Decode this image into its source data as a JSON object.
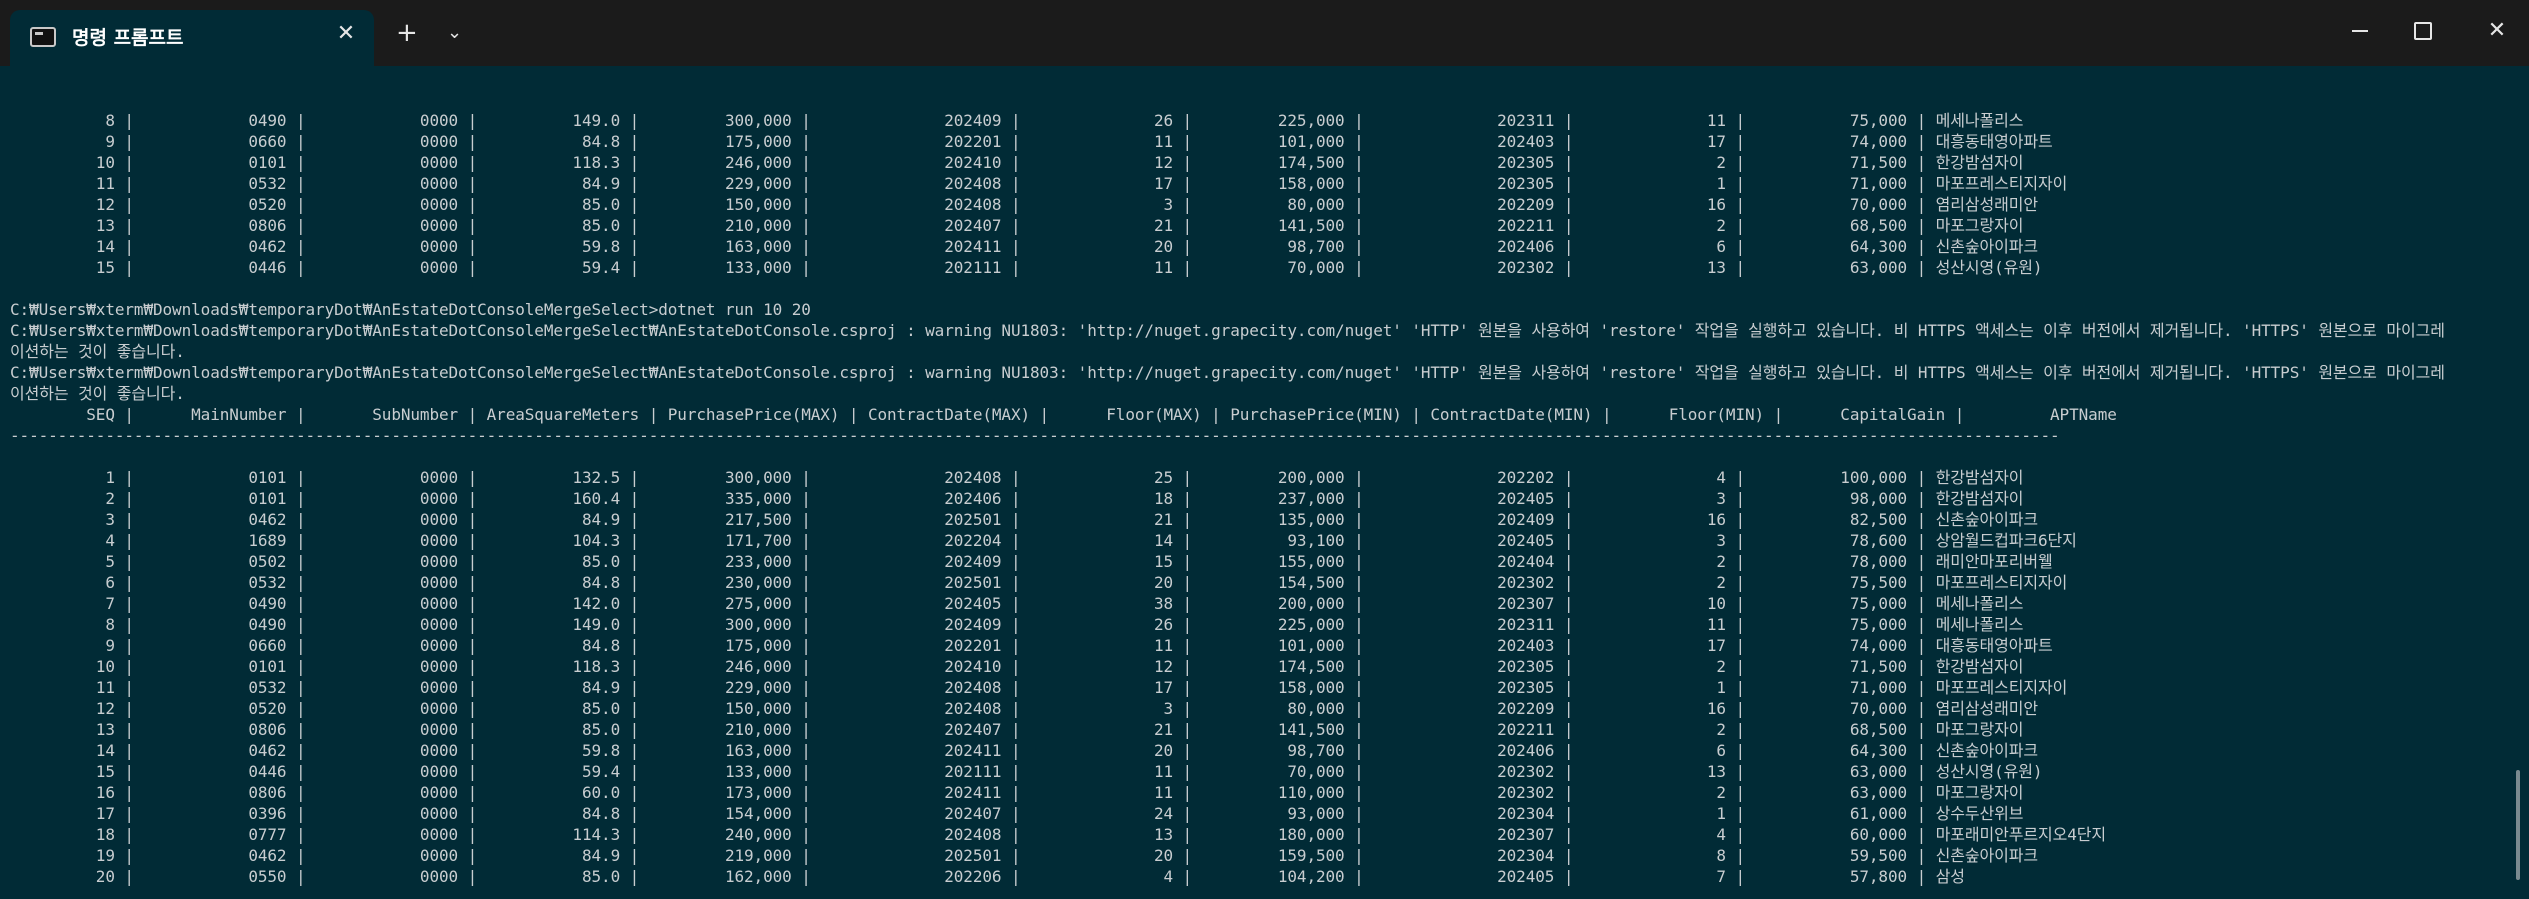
{
  "window": {
    "tab_title": "명령 프롬프트",
    "tab_icon": "terminal-icon",
    "close_tab_glyph": "✕",
    "new_tab_glyph": "+",
    "dropdown_glyph": "⌄",
    "close_window_glyph": "✕"
  },
  "terminal": {
    "lines": [
      "          8 |            0490 |            0000 |          149.0 |         300,000 |              202409 |              26 |         225,000 |              202311 |              11 |           75,000 | 메세나폴리스",
      "          9 |            0660 |            0000 |           84.8 |         175,000 |              202201 |              11 |         101,000 |              202403 |              17 |           74,000 | 대흥동태영아파트",
      "         10 |            0101 |            0000 |          118.3 |         246,000 |              202410 |              12 |         174,500 |              202305 |               2 |           71,500 | 한강밤섬자이",
      "         11 |            0532 |            0000 |           84.9 |         229,000 |              202408 |              17 |         158,000 |              202305 |               1 |           71,000 | 마포프레스티지자이",
      "         12 |            0520 |            0000 |           85.0 |         150,000 |              202408 |               3 |          80,000 |              202209 |              16 |           70,000 | 염리삼성래미안",
      "         13 |            0806 |            0000 |           85.0 |         210,000 |              202407 |              21 |         141,500 |              202211 |               2 |           68,500 | 마포그랑자이",
      "         14 |            0462 |            0000 |           59.8 |         163,000 |              202411 |              20 |          98,700 |              202406 |               6 |           64,300 | 신촌숲아이파크",
      "         15 |            0446 |            0000 |           59.4 |         133,000 |              202111 |              11 |          70,000 |              202302 |              13 |           63,000 | 성산시영(유원)",
      "",
      "C:₩Users₩xterm₩Downloads₩temporaryDot₩AnEstateDotConsoleMergeSelect>dotnet run 10 20",
      "C:₩Users₩xterm₩Downloads₩temporaryDot₩AnEstateDotConsoleMergeSelect₩AnEstateDotConsole.csproj : warning NU1803: 'http://nuget.grapecity.com/nuget' 'HTTP' 원본을 사용하여 'restore' 작업을 실행하고 있습니다. 비 HTTPS 액세스는 이후 버전에서 제거됩니다. 'HTTPS' 원본으로 마이그레",
      "이션하는 것이 좋습니다.",
      "C:₩Users₩xterm₩Downloads₩temporaryDot₩AnEstateDotConsoleMergeSelect₩AnEstateDotConsole.csproj : warning NU1803: 'http://nuget.grapecity.com/nuget' 'HTTP' 원본을 사용하여 'restore' 작업을 실행하고 있습니다. 비 HTTPS 액세스는 이후 버전에서 제거됩니다. 'HTTPS' 원본으로 마이그레",
      "이션하는 것이 좋습니다.",
      "        SEQ |      MainNumber |       SubNumber | AreaSquareMeters | PurchasePrice(MAX) | ContractDate(MAX) |      Floor(MAX) | PurchasePrice(MIN) | ContractDate(MIN) |      Floor(MIN) |      CapitalGain |         APTName",
      "-----------------------------------------------------------------------------------------------------------------------------------------------------------------------------------------------------------------------",
      "",
      "          1 |            0101 |            0000 |          132.5 |         300,000 |              202408 |              25 |         200,000 |              202202 |               4 |          100,000 | 한강밤섬자이",
      "          2 |            0101 |            0000 |          160.4 |         335,000 |              202406 |              18 |         237,000 |              202405 |               3 |           98,000 | 한강밤섬자이",
      "          3 |            0462 |            0000 |           84.9 |         217,500 |              202501 |              21 |         135,000 |              202409 |              16 |           82,500 | 신촌숲아이파크",
      "          4 |            1689 |            0000 |          104.3 |         171,700 |              202204 |              14 |          93,100 |              202405 |               3 |           78,600 | 상암월드컵파크6단지",
      "          5 |            0502 |            0000 |           85.0 |         233,000 |              202409 |              15 |         155,000 |              202404 |               2 |           78,000 | 래미안마포리버웰",
      "          6 |            0532 |            0000 |           84.8 |         230,000 |              202501 |              20 |         154,500 |              202302 |               2 |           75,500 | 마포프레스티지자이",
      "          7 |            0490 |            0000 |          142.0 |         275,000 |              202405 |              38 |         200,000 |              202307 |              10 |           75,000 | 메세나폴리스",
      "          8 |            0490 |            0000 |          149.0 |         300,000 |              202409 |              26 |         225,000 |              202311 |              11 |           75,000 | 메세나폴리스",
      "          9 |            0660 |            0000 |           84.8 |         175,000 |              202201 |              11 |         101,000 |              202403 |              17 |           74,000 | 대흥동태영아파트",
      "         10 |            0101 |            0000 |          118.3 |         246,000 |              202410 |              12 |         174,500 |              202305 |               2 |           71,500 | 한강밤섬자이",
      "         11 |            0532 |            0000 |           84.9 |         229,000 |              202408 |              17 |         158,000 |              202305 |               1 |           71,000 | 마포프레스티지자이",
      "         12 |            0520 |            0000 |           85.0 |         150,000 |              202408 |               3 |          80,000 |              202209 |              16 |           70,000 | 염리삼성래미안",
      "         13 |            0806 |            0000 |           85.0 |         210,000 |              202407 |              21 |         141,500 |              202211 |               2 |           68,500 | 마포그랑자이",
      "         14 |            0462 |            0000 |           59.8 |         163,000 |              202411 |              20 |          98,700 |              202406 |               6 |           64,300 | 신촌숲아이파크",
      "         15 |            0446 |            0000 |           59.4 |         133,000 |              202111 |              11 |          70,000 |              202302 |              13 |           63,000 | 성산시영(유원)",
      "         16 |            0806 |            0000 |           60.0 |         173,000 |              202411 |              11 |         110,000 |              202302 |               2 |           63,000 | 마포그랑자이",
      "         17 |            0396 |            0000 |           84.8 |         154,000 |              202407 |              24 |          93,000 |              202304 |               1 |           61,000 | 상수두산위브",
      "         18 |            0777 |            0000 |          114.3 |         240,000 |              202408 |              13 |         180,000 |              202307 |               4 |           60,000 | 마포래미안푸르지오4단지",
      "         19 |            0462 |            0000 |           84.9 |         219,000 |              202501 |              20 |         159,500 |              202304 |               8 |           59,500 | 신촌숲아이파크",
      "         20 |            0550 |            0000 |           85.0 |         162,000 |              202206 |               4 |         104,200 |              202405 |               7 |           57,800 | 삼성",
      ""
    ],
    "prompt": "C:₩Users₩xterm₩Downloads₩temporaryDot₩AnEstateDotConsoleMergeSelect>"
  }
}
